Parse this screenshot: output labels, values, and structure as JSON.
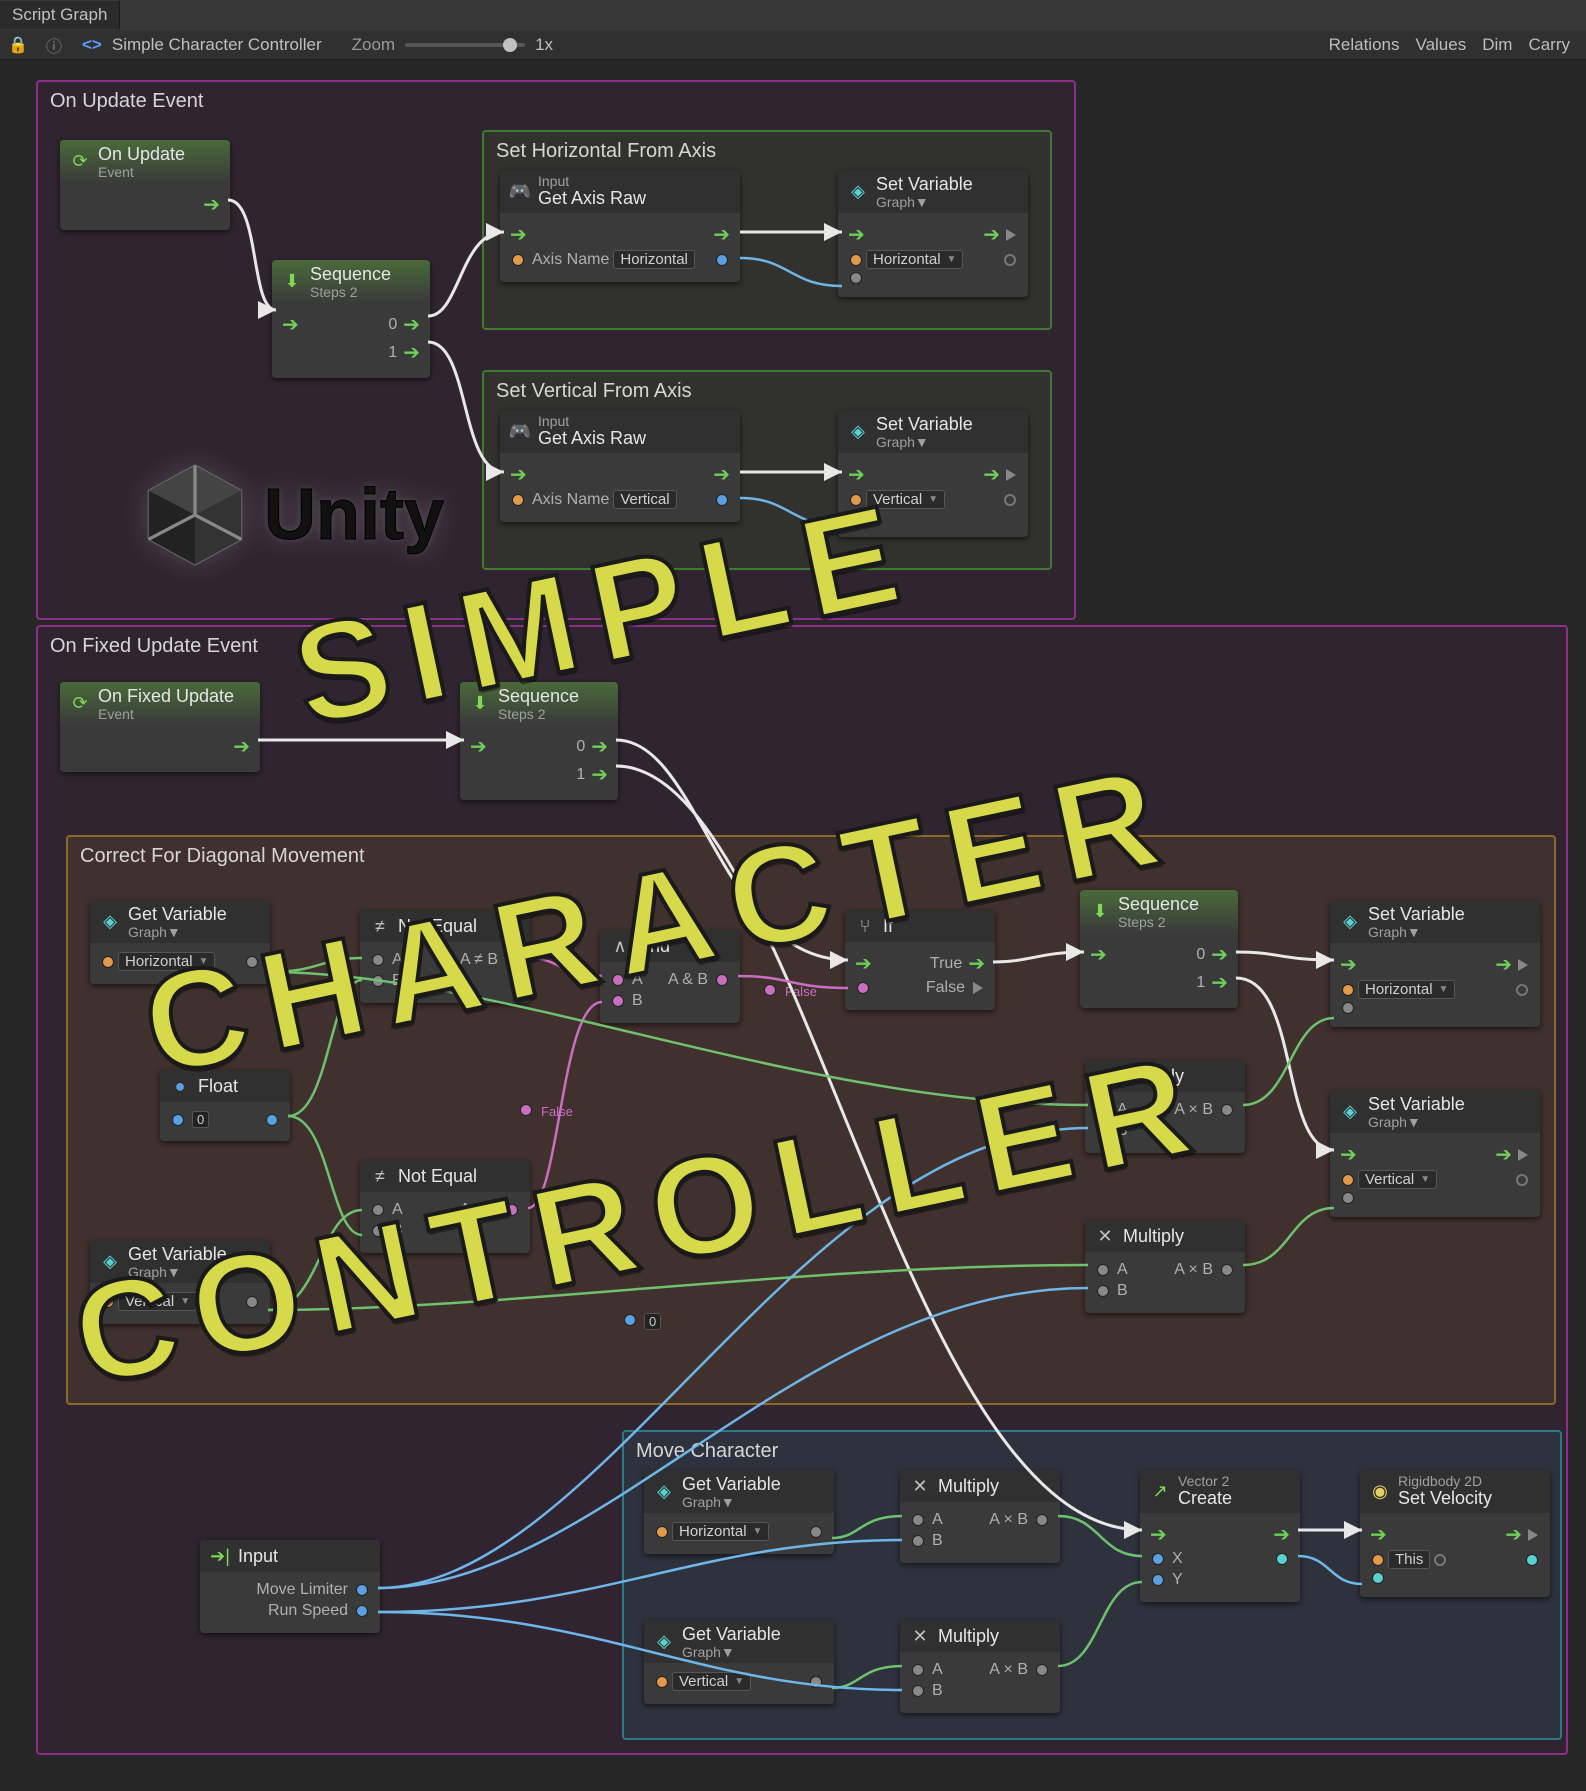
{
  "toolbar": {
    "tab": "Script Graph",
    "lock_icon": "lock-icon",
    "info_icon": "info-icon",
    "graph_icon": "graph-icon",
    "breadcrumb": "Simple Character Controller",
    "zoom_label": "Zoom",
    "zoom_value": "1x",
    "right_buttons": [
      "Relations",
      "Values",
      "Dim",
      "Carry"
    ]
  },
  "groups": {
    "on_update": {
      "title": "On Update Event"
    },
    "set_h": {
      "title": "Set Horizontal From Axis"
    },
    "set_v": {
      "title": "Set Vertical From Axis"
    },
    "on_fixed": {
      "title": "On Fixed Update Event"
    },
    "correct_diag": {
      "title": "Correct For Diagonal Movement"
    },
    "move_char": {
      "title": "Move Character"
    }
  },
  "nodes": {
    "on_update": {
      "sub": "",
      "title": "On Update",
      "sub2": "Event"
    },
    "sequence1": {
      "title": "Sequence",
      "steps_label": "Steps",
      "steps": "2",
      "idx0": "0",
      "idx1": "1"
    },
    "get_axis_h": {
      "sub": "Input",
      "title": "Get Axis Raw",
      "param_label": "Axis Name",
      "param_value": "Horizontal"
    },
    "get_axis_v": {
      "sub": "Input",
      "title": "Get Axis Raw",
      "param_label": "Axis Name",
      "param_value": "Vertical"
    },
    "set_var_h": {
      "title": "Set Variable",
      "scope": "Graph",
      "var": "Horizontal"
    },
    "set_var_v": {
      "title": "Set Variable",
      "scope": "Graph",
      "var": "Vertical"
    },
    "on_fixed_update": {
      "title": "On Fixed Update",
      "sub2": "Event"
    },
    "sequence2": {
      "title": "Sequence",
      "steps_label": "Steps",
      "steps": "2",
      "idx0": "0",
      "idx1": "1"
    },
    "get_var_h": {
      "title": "Get Variable",
      "scope": "Graph",
      "var": "Horizontal"
    },
    "get_var_v": {
      "title": "Get Variable",
      "scope": "Graph",
      "var": "Vertical"
    },
    "float_lit": {
      "title": "Float",
      "value": "0"
    },
    "not_equal_a": {
      "title": "Not Equal",
      "a": "A",
      "b": "B",
      "out": "A ≠ B"
    },
    "not_equal_b": {
      "title": "Not Equal",
      "a": "A",
      "b": "B",
      "out": "A ≠ B"
    },
    "and": {
      "title": "And",
      "a": "A",
      "b": "B",
      "out": "A & B"
    },
    "if": {
      "title": "If",
      "true": "True",
      "false": "False"
    },
    "sequence3": {
      "title": "Sequence",
      "steps_label": "Steps",
      "steps": "2",
      "idx0": "0",
      "idx1": "1"
    },
    "set_var_h2": {
      "title": "Set Variable",
      "scope": "Graph",
      "var": "Horizontal"
    },
    "set_var_v2": {
      "title": "Set Variable",
      "scope": "Graph",
      "var": "Vertical"
    },
    "multiply1": {
      "title": "Multiply",
      "a": "A",
      "b": "B",
      "out": "A × B"
    },
    "multiply2": {
      "title": "Multiply",
      "a": "A",
      "b": "B",
      "out": "A × B"
    },
    "input_node": {
      "title": "Input",
      "p1": "Move Limiter",
      "p2": "Run Speed"
    },
    "get_var_h3": {
      "title": "Get Variable",
      "scope": "Graph",
      "var": "Horizontal"
    },
    "get_var_v3": {
      "title": "Get Variable",
      "scope": "Graph",
      "var": "Vertical"
    },
    "multiply3": {
      "title": "Multiply",
      "a": "A",
      "b": "B",
      "out": "A × B"
    },
    "multiply4": {
      "title": "Multiply",
      "a": "A",
      "b": "B",
      "out": "A × B"
    },
    "vec2_create": {
      "sub": "Vector 2",
      "title": "Create",
      "x": "X",
      "y": "Y"
    },
    "rb_setvel": {
      "sub": "Rigidbody 2D",
      "title": "Set Velocity",
      "target": "This"
    },
    "false_lit": {
      "title": "False"
    },
    "zero_lit": {
      "title": "0"
    }
  },
  "overlay": {
    "line1": "SIMPLE",
    "line2": "CHARACTER",
    "line3": "CONTROLLER",
    "unity": "Unity"
  }
}
